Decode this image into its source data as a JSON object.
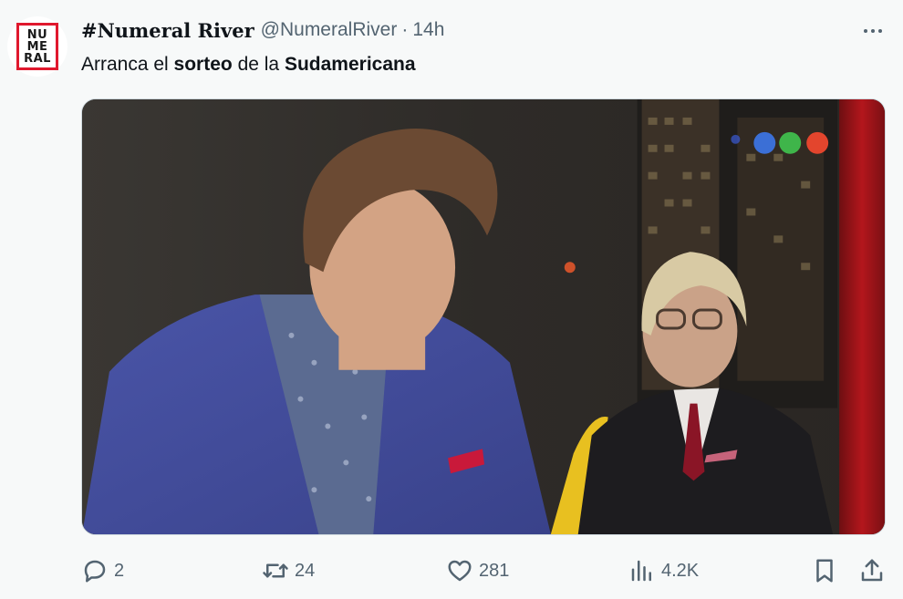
{
  "author": {
    "avatar_lines": [
      "NU",
      "ME",
      "RAL"
    ],
    "display_name": "#Numeral River",
    "handle": "@NumeralRiver",
    "separator": "·",
    "time": "14h"
  },
  "tweet": {
    "text_segments": [
      {
        "text": "Arranca el ",
        "bold": false
      },
      {
        "text": "sorteo",
        "bold": true
      },
      {
        "text": " de la ",
        "bold": false
      },
      {
        "text": "Sudamericana",
        "bold": true
      }
    ]
  },
  "media": {
    "type": "video-still",
    "description_icon": "tv-channel-logo"
  },
  "actions": {
    "reply": {
      "icon": "reply-icon",
      "count": "2"
    },
    "retweet": {
      "icon": "retweet-icon",
      "count": "24"
    },
    "like": {
      "icon": "heart-icon",
      "count": "281"
    },
    "views": {
      "icon": "views-icon",
      "count": "4.2K"
    },
    "bookmark": {
      "icon": "bookmark-icon"
    },
    "share": {
      "icon": "share-icon"
    }
  },
  "colors": {
    "background": "#f7f9f9",
    "text_primary": "#0f1419",
    "text_secondary": "#536471",
    "avatar_border": "#e0182d"
  }
}
